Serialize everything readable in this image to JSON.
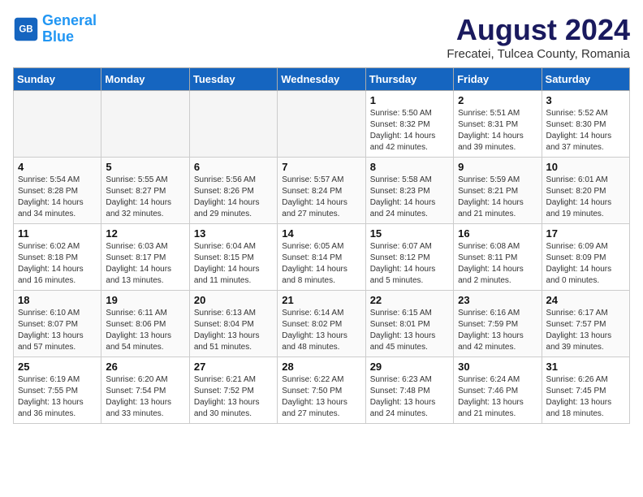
{
  "header": {
    "logo_line1": "General",
    "logo_line2": "Blue",
    "month_year": "August 2024",
    "location": "Frecatei, Tulcea County, Romania"
  },
  "weekdays": [
    "Sunday",
    "Monday",
    "Tuesday",
    "Wednesday",
    "Thursday",
    "Friday",
    "Saturday"
  ],
  "weeks": [
    [
      {
        "day": "",
        "info": ""
      },
      {
        "day": "",
        "info": ""
      },
      {
        "day": "",
        "info": ""
      },
      {
        "day": "",
        "info": ""
      },
      {
        "day": "1",
        "info": "Sunrise: 5:50 AM\nSunset: 8:32 PM\nDaylight: 14 hours\nand 42 minutes."
      },
      {
        "day": "2",
        "info": "Sunrise: 5:51 AM\nSunset: 8:31 PM\nDaylight: 14 hours\nand 39 minutes."
      },
      {
        "day": "3",
        "info": "Sunrise: 5:52 AM\nSunset: 8:30 PM\nDaylight: 14 hours\nand 37 minutes."
      }
    ],
    [
      {
        "day": "4",
        "info": "Sunrise: 5:54 AM\nSunset: 8:28 PM\nDaylight: 14 hours\nand 34 minutes."
      },
      {
        "day": "5",
        "info": "Sunrise: 5:55 AM\nSunset: 8:27 PM\nDaylight: 14 hours\nand 32 minutes."
      },
      {
        "day": "6",
        "info": "Sunrise: 5:56 AM\nSunset: 8:26 PM\nDaylight: 14 hours\nand 29 minutes."
      },
      {
        "day": "7",
        "info": "Sunrise: 5:57 AM\nSunset: 8:24 PM\nDaylight: 14 hours\nand 27 minutes."
      },
      {
        "day": "8",
        "info": "Sunrise: 5:58 AM\nSunset: 8:23 PM\nDaylight: 14 hours\nand 24 minutes."
      },
      {
        "day": "9",
        "info": "Sunrise: 5:59 AM\nSunset: 8:21 PM\nDaylight: 14 hours\nand 21 minutes."
      },
      {
        "day": "10",
        "info": "Sunrise: 6:01 AM\nSunset: 8:20 PM\nDaylight: 14 hours\nand 19 minutes."
      }
    ],
    [
      {
        "day": "11",
        "info": "Sunrise: 6:02 AM\nSunset: 8:18 PM\nDaylight: 14 hours\nand 16 minutes."
      },
      {
        "day": "12",
        "info": "Sunrise: 6:03 AM\nSunset: 8:17 PM\nDaylight: 14 hours\nand 13 minutes."
      },
      {
        "day": "13",
        "info": "Sunrise: 6:04 AM\nSunset: 8:15 PM\nDaylight: 14 hours\nand 11 minutes."
      },
      {
        "day": "14",
        "info": "Sunrise: 6:05 AM\nSunset: 8:14 PM\nDaylight: 14 hours\nand 8 minutes."
      },
      {
        "day": "15",
        "info": "Sunrise: 6:07 AM\nSunset: 8:12 PM\nDaylight: 14 hours\nand 5 minutes."
      },
      {
        "day": "16",
        "info": "Sunrise: 6:08 AM\nSunset: 8:11 PM\nDaylight: 14 hours\nand 2 minutes."
      },
      {
        "day": "17",
        "info": "Sunrise: 6:09 AM\nSunset: 8:09 PM\nDaylight: 14 hours\nand 0 minutes."
      }
    ],
    [
      {
        "day": "18",
        "info": "Sunrise: 6:10 AM\nSunset: 8:07 PM\nDaylight: 13 hours\nand 57 minutes."
      },
      {
        "day": "19",
        "info": "Sunrise: 6:11 AM\nSunset: 8:06 PM\nDaylight: 13 hours\nand 54 minutes."
      },
      {
        "day": "20",
        "info": "Sunrise: 6:13 AM\nSunset: 8:04 PM\nDaylight: 13 hours\nand 51 minutes."
      },
      {
        "day": "21",
        "info": "Sunrise: 6:14 AM\nSunset: 8:02 PM\nDaylight: 13 hours\nand 48 minutes."
      },
      {
        "day": "22",
        "info": "Sunrise: 6:15 AM\nSunset: 8:01 PM\nDaylight: 13 hours\nand 45 minutes."
      },
      {
        "day": "23",
        "info": "Sunrise: 6:16 AM\nSunset: 7:59 PM\nDaylight: 13 hours\nand 42 minutes."
      },
      {
        "day": "24",
        "info": "Sunrise: 6:17 AM\nSunset: 7:57 PM\nDaylight: 13 hours\nand 39 minutes."
      }
    ],
    [
      {
        "day": "25",
        "info": "Sunrise: 6:19 AM\nSunset: 7:55 PM\nDaylight: 13 hours\nand 36 minutes."
      },
      {
        "day": "26",
        "info": "Sunrise: 6:20 AM\nSunset: 7:54 PM\nDaylight: 13 hours\nand 33 minutes."
      },
      {
        "day": "27",
        "info": "Sunrise: 6:21 AM\nSunset: 7:52 PM\nDaylight: 13 hours\nand 30 minutes."
      },
      {
        "day": "28",
        "info": "Sunrise: 6:22 AM\nSunset: 7:50 PM\nDaylight: 13 hours\nand 27 minutes."
      },
      {
        "day": "29",
        "info": "Sunrise: 6:23 AM\nSunset: 7:48 PM\nDaylight: 13 hours\nand 24 minutes."
      },
      {
        "day": "30",
        "info": "Sunrise: 6:24 AM\nSunset: 7:46 PM\nDaylight: 13 hours\nand 21 minutes."
      },
      {
        "day": "31",
        "info": "Sunrise: 6:26 AM\nSunset: 7:45 PM\nDaylight: 13 hours\nand 18 minutes."
      }
    ]
  ]
}
